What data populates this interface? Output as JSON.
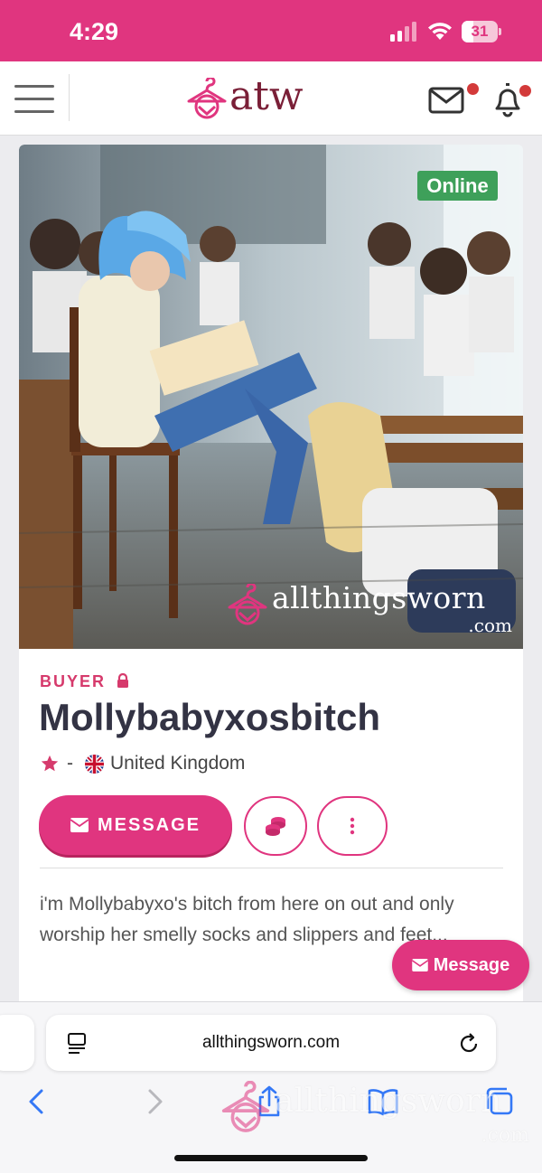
{
  "status_bar": {
    "time": "4:29",
    "battery": "31",
    "icons": [
      "cellular-signal-icon",
      "wifi-icon",
      "battery-icon"
    ]
  },
  "header": {
    "logo_text": "atw",
    "icons": [
      "hamburger-menu-icon",
      "mail-icon",
      "bell-icon"
    ],
    "notification_dots": true
  },
  "profile": {
    "online_badge": "Online",
    "watermark_text": "allthingsworn",
    "watermark_suffix": ".com",
    "role": "BUYER",
    "username": "Mollybabyxosbitch",
    "rating": "-",
    "country": "United Kingdom",
    "message_button": "MESSAGE",
    "bio": "i'm Mollybabyxo's bitch from here on out and only worship her smelly socks and slippers and feet..."
  },
  "floating_button": {
    "label": "Message"
  },
  "browser": {
    "url": "allthingsworn.com",
    "icons": [
      "reader-icon",
      "reload-icon",
      "back-icon",
      "forward-icon",
      "share-icon",
      "bookmarks-icon",
      "tabs-icon"
    ]
  },
  "colors": {
    "brand_pink": "#e0357f",
    "logo_maroon": "#7a1f37",
    "online_green": "#3ea05a",
    "ios_blue": "#3478f6"
  }
}
